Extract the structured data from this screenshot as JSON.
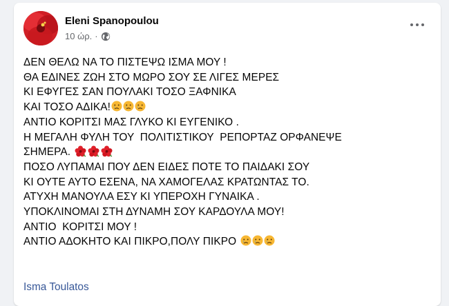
{
  "post": {
    "author": "Eleni Spanopoulou",
    "time": "10 ώρ.",
    "separator": "·",
    "privacy_icon": "globe-icon",
    "menu_icon": "more-options-icon",
    "lines": [
      "ΔΕΝ ΘΕΛΩ ΝΑ ΤΟ ΠΙΣΤΕΨΩ ΙΣΜΑ ΜΟΥ !",
      "ΘΑ ΕΔΙΝΕΣ ΖΩΗ ΣΤΟ ΜΩΡΟ ΣΟΥ ΣΕ ΛΙΓΕΣ ΜΕΡΕΣ",
      "ΚΙ ΕΦΥΓΕΣ ΣΑΝ ΠΟΥΛΑΚΙ ΤΟΣΟ ΞΑΦΝΙΚΑ",
      "ΚΑΙ ΤΟΣΟ ΑΔΙΚΑ!",
      "ΑΝΤΙΟ ΚΟΡΙΤΣΙ ΜΑΣ ΓΛΥΚΟ ΚΙ ΕΥΓΕΝΙΚΟ .",
      "Η ΜΕΓΑΛΗ ΦΥΛΗ ΤΟΥ  ΠΟΛΙΤΙΣΤΙΚΟΥ  ΡΕΠΟΡΤΑΖ ΟΡΦΑΝΕΨΕ",
      "ΣΗΜΕΡΑ. ",
      "ΠΟΣΟ ΛΥΠΑΜΑΙ ΠΟΥ ΔΕΝ ΕΙΔΕΣ ΠΟΤΕ ΤΟ ΠΑΙΔΑΚΙ ΣΟΥ",
      "ΚΙ ΟΥΤΕ ΑΥΤΟ ΕΣΕΝΑ, ΝΑ ΧΑΜΟΓΕΛΑΣ ΚΡΑΤΩΝΤΑΣ ΤΟ.",
      "ΑΤΥΧΗ ΜΑΝΟΥΛΑ ΕΣΥ ΚΙ ΥΠΕΡΟΧΗ ΓΥΝΑΙΚΑ .",
      "ΥΠΟΚΛΙΝΟΜΑΙ ΣΤΗ ΔΥΝΑΜΗ ΣΟΥ ΚΑΡΔΟΥΛΑ ΜΟΥ!",
      "ΑΝΤΙΟ  ΚΟΡΙΤΣΙ ΜΟΥ !",
      "ΑΝΤΙΟ ΑΔΟΚΗΤΟ ΚΑΙ ΠΙΚΡΟ,ΠΟΛΥ ΠΙΚΡΟ "
    ],
    "emoji_sad": "crying-face-emoji",
    "emoji_flower": "hibiscus-emoji",
    "tagged_person": "Isma Toulatos"
  },
  "colors": {
    "link": "#385898",
    "secondary_text": "#65676b",
    "avatar_red": "#c4161c"
  }
}
